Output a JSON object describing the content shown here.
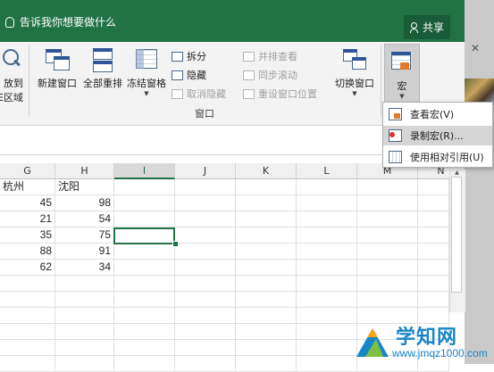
{
  "titlebar": {
    "tell_me": "告诉我你想要做什么",
    "share_label": "共享",
    "color": "#217346"
  },
  "ribbon": {
    "partial_button_label_line1": "放到",
    "partial_button_label_line2": "E区域",
    "new_window": "新建窗口",
    "arrange_all": "全部重排",
    "freeze_panes": "冻结窗格",
    "split": "拆分",
    "hide": "隐藏",
    "unhide": "取消隐藏",
    "view_side_by_side": "并排查看",
    "sync_scroll": "同步滚动",
    "reset_window_position": "重设窗口位置",
    "switch_windows": "切换窗口",
    "macros": "宏",
    "group_window": "窗口"
  },
  "grid": {
    "columns": [
      {
        "letter": "G"
      },
      {
        "letter": "H"
      },
      {
        "letter": "I",
        "selected": true
      },
      {
        "letter": "J"
      },
      {
        "letter": "K"
      },
      {
        "letter": "L"
      },
      {
        "letter": "M"
      },
      {
        "letter": "N"
      }
    ],
    "header_row": [
      "杭州",
      "沈阳"
    ],
    "rows": [
      [
        "45",
        "98"
      ],
      [
        "21",
        "54"
      ],
      [
        "35",
        "75"
      ],
      [
        "88",
        "91"
      ],
      [
        "62",
        "34"
      ]
    ]
  },
  "macro_menu": {
    "items": [
      {
        "label": "查看宏(V)",
        "icon": "view-macros-icon"
      },
      {
        "label": "录制宏(R)...",
        "icon": "record-macro-icon",
        "highlighted": true
      },
      {
        "label": "使用相对引用(U)",
        "icon": "relative-reference-icon"
      }
    ]
  },
  "watermark": {
    "title": "学知网",
    "url": "www.jmqz1000.com"
  }
}
